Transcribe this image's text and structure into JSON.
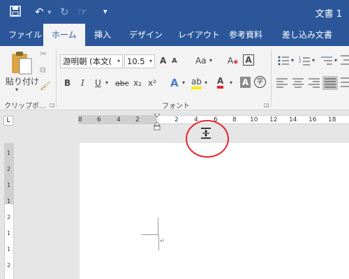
{
  "titlebar": {
    "doc_title": "文書 1"
  },
  "tabs": [
    {
      "label": "ファイル",
      "active": false
    },
    {
      "label": "ホーム",
      "active": true
    },
    {
      "label": "挿入",
      "active": false
    },
    {
      "label": "デザイン",
      "active": false
    },
    {
      "label": "レイアウト",
      "active": false
    },
    {
      "label": "参考資料",
      "active": false
    },
    {
      "label": "差し込み文書",
      "active": false
    }
  ],
  "ribbon": {
    "clipboard": {
      "paste_label": "貼り付け",
      "group_label": "クリップボ…"
    },
    "font": {
      "group_label": "フォント",
      "font_name": "游明朝 (本文(",
      "font_size": "10.5",
      "grow": "A",
      "shrink": "A",
      "case": "Aa",
      "clear": "A",
      "border": "A",
      "bold": "B",
      "italic": "I",
      "underline": "U",
      "strike": "abc",
      "subscript": "x₂",
      "superscript": "x²",
      "effect": "A",
      "highlight": "ab",
      "color": "A",
      "shade": "A",
      "enclose": "字"
    }
  },
  "ruler": {
    "hticks": [
      "8",
      "6",
      "4",
      "2",
      "2",
      "4",
      "6",
      "8",
      "10",
      "12",
      "14",
      "16",
      "18"
    ],
    "vticks": [
      "1",
      "2",
      "1",
      "1",
      "2",
      "1",
      "1",
      "2"
    ],
    "tab_selector": "L"
  },
  "document": {
    "paragraph_mark": "↵"
  },
  "colors": {
    "accent": "#2b579a",
    "highlight_circle": "#e8232a",
    "ribbon_bg": "#f3f3f3"
  }
}
